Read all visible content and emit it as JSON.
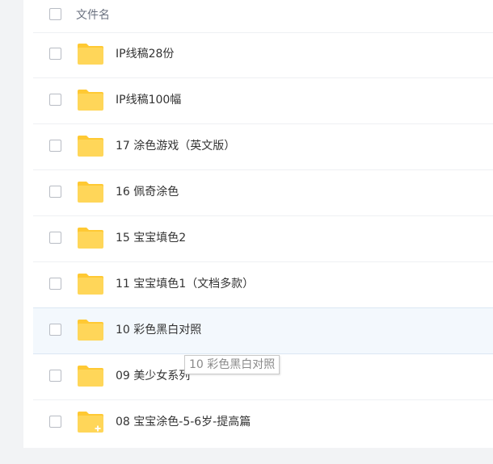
{
  "header": {
    "column_label": "文件名"
  },
  "files": [
    {
      "name": "IP线稿28份",
      "icon": "folder-icon"
    },
    {
      "name": "IP线稿100幅",
      "icon": "folder-icon"
    },
    {
      "name": "17 涂色游戏（英文版）",
      "icon": "folder-icon"
    },
    {
      "name": "16 佩奇涂色",
      "icon": "folder-icon"
    },
    {
      "name": "15 宝宝填色2",
      "icon": "folder-icon"
    },
    {
      "name": "11 宝宝填色1（文档多款）",
      "icon": "folder-icon"
    },
    {
      "name": "10 彩色黑白对照",
      "icon": "folder-icon",
      "hovered": true
    },
    {
      "name": "09 美少女系列",
      "icon": "folder-icon"
    },
    {
      "name": "08 宝宝涂色-5-6岁-提高篇",
      "icon": "shared-folder-icon"
    }
  ],
  "tooltip": {
    "text": "10 彩色黑白对照"
  },
  "colors": {
    "folder": "#ffd659",
    "folder_tab": "#ffc933",
    "hover_row": "#f3f8fd"
  }
}
